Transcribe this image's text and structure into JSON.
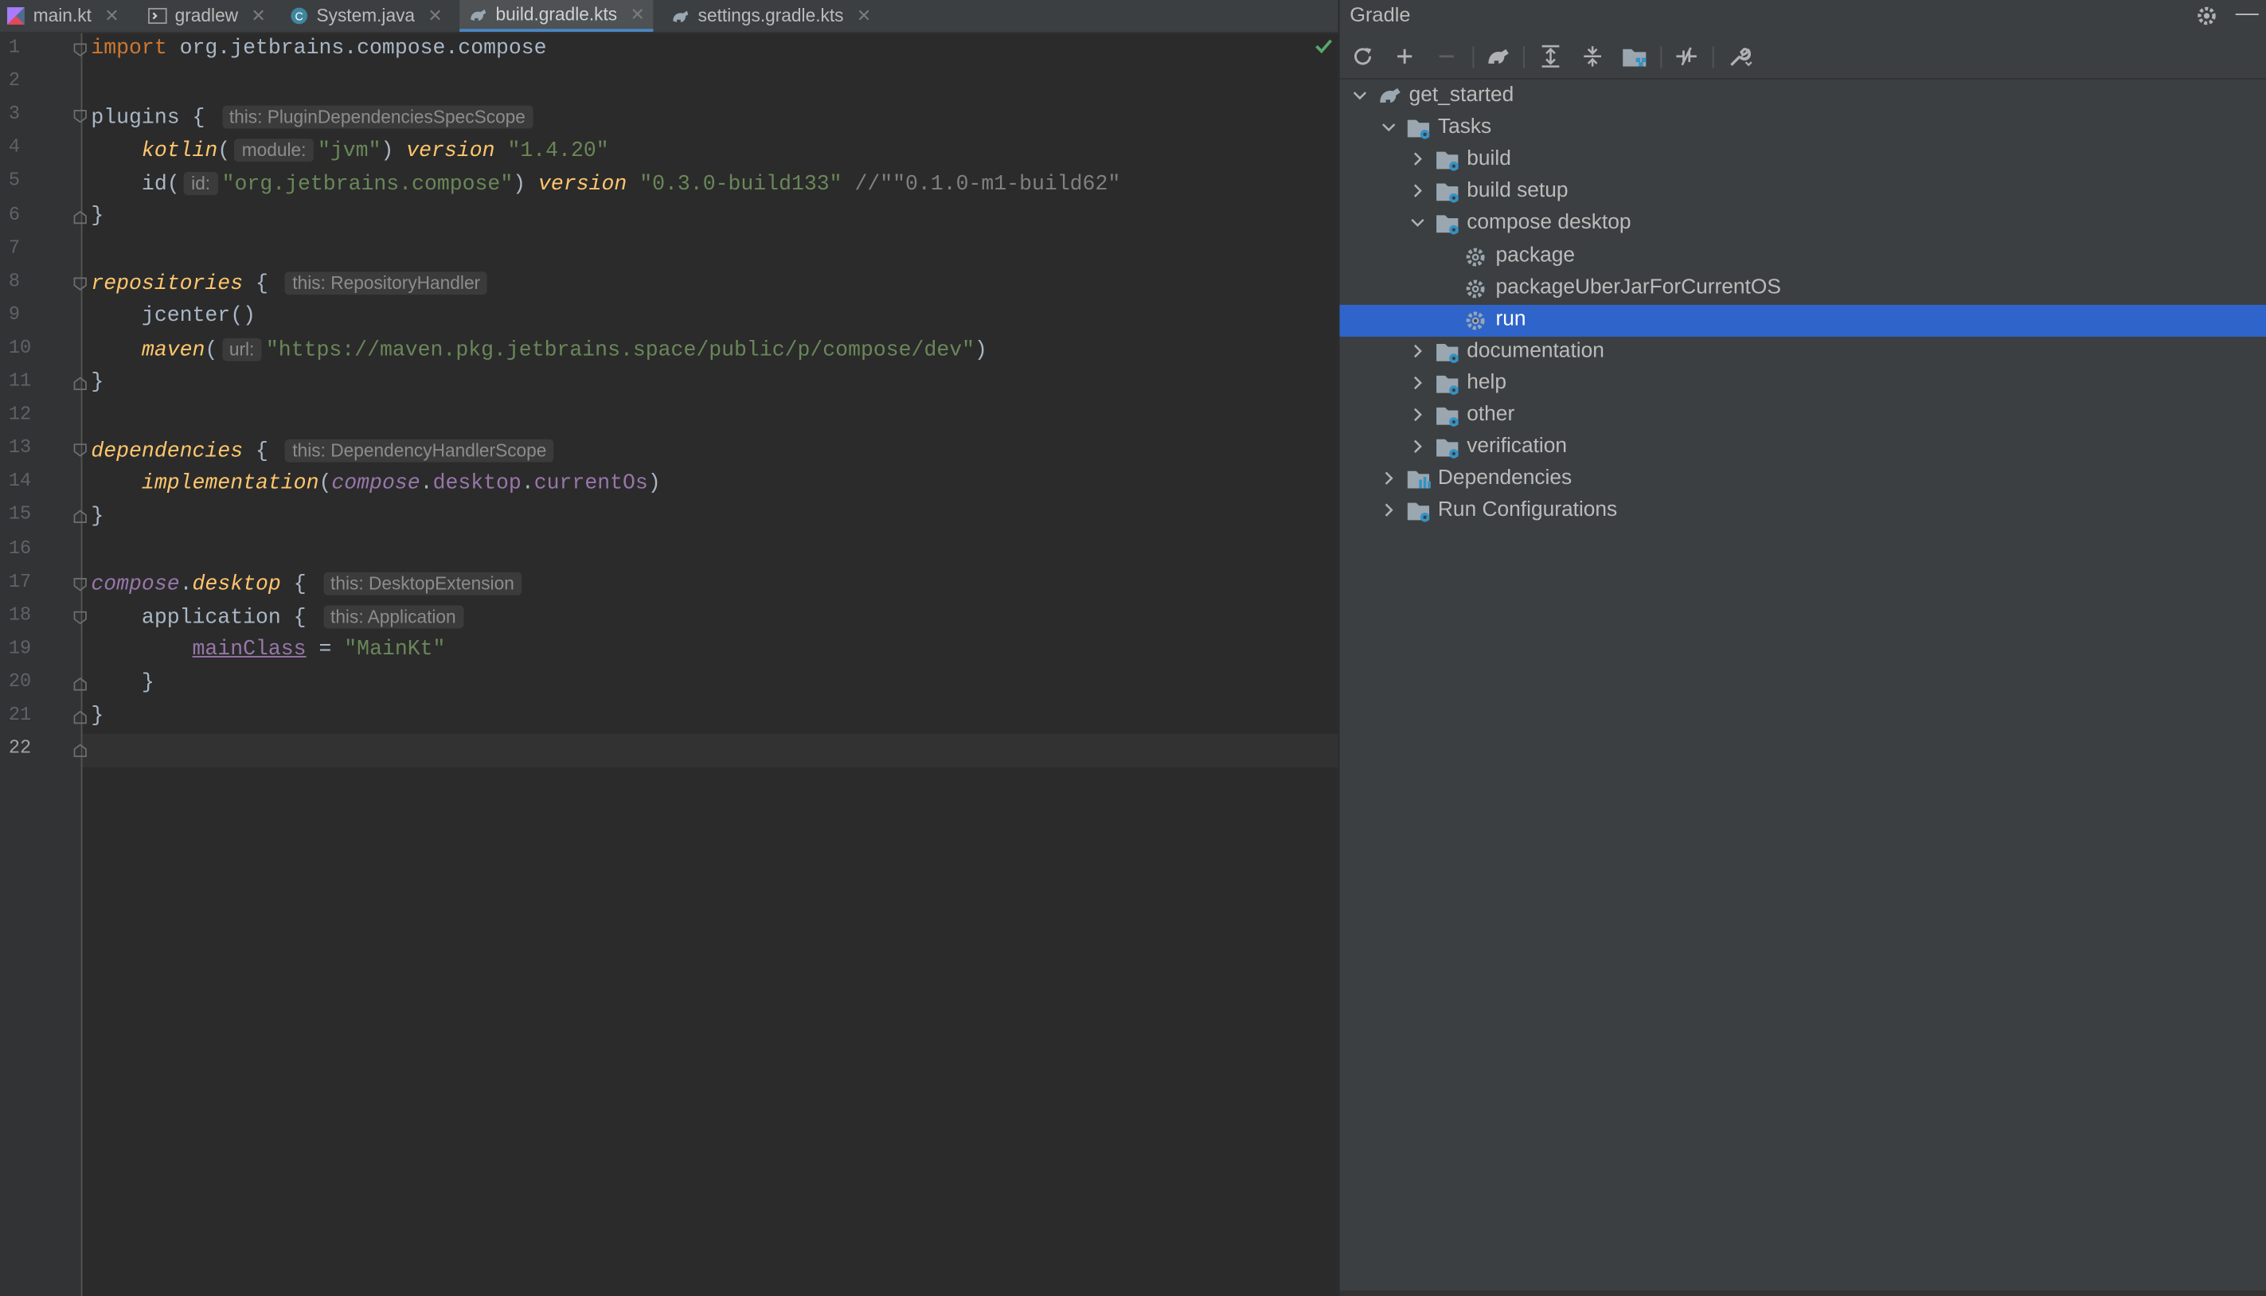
{
  "editor": {
    "tabs": [
      {
        "label": "main.kt",
        "icon": "kotlin-file-icon",
        "active": false
      },
      {
        "label": "gradlew",
        "icon": "terminal-file-icon",
        "active": false
      },
      {
        "label": "System.java",
        "icon": "java-class-icon",
        "active": false
      },
      {
        "label": "build.gradle.kts",
        "icon": "gradle-file-icon",
        "active": true
      },
      {
        "label": "settings.gradle.kts",
        "icon": "gradle-file-icon",
        "active": false
      }
    ],
    "line_numbers": [
      "1",
      "2",
      "3",
      "4",
      "5",
      "6",
      "7",
      "8",
      "9",
      "10",
      "11",
      "12",
      "13",
      "14",
      "15",
      "16",
      "17",
      "18",
      "19",
      "20",
      "21",
      "22"
    ],
    "current_line": "22",
    "code": {
      "l1": {
        "kw": "import",
        "rest": " org.jetbrains.compose.compose"
      },
      "l3": {
        "name": "plugins",
        "brace": " {",
        "hint": "this: PluginDependenciesSpecScope"
      },
      "l4": {
        "indent": "    ",
        "fn": "kotlin",
        "open": "(",
        "hint": "module:",
        "str": "\"jvm\"",
        "close": ") ",
        "fn2": "version",
        "sp": " ",
        "str2": "\"1.4.20\""
      },
      "l5": {
        "indent": "    ",
        "name": "id(",
        "hint": "id:",
        "str": "\"org.jetbrains.compose\"",
        "close": ") ",
        "fn2": "version",
        "sp": " ",
        "str2": "\"0.3.0-build133\"",
        "cm": " //\"\"0.1.0-m1-build62\""
      },
      "l6": {
        "text": "}"
      },
      "l8": {
        "fn": "repositories",
        "brace": " {",
        "hint": "this: RepositoryHandler"
      },
      "l9": {
        "text": "    jcenter()"
      },
      "l10": {
        "indent": "    ",
        "fn": "maven",
        "open": "(",
        "hint": "url:",
        "str": "\"https://maven.pkg.jetbrains.space/public/p/compose/dev\"",
        "close": ")"
      },
      "l11": {
        "text": "}"
      },
      "l13": {
        "fn": "dependencies",
        "brace": " {",
        "hint": "this: DependencyHandlerScope"
      },
      "l14": {
        "indent": "    ",
        "fn": "implementation",
        "open": "(",
        "p1": "compose",
        "dot1": ".",
        "p2": "desktop",
        "dot2": ".",
        "p3": "currentOs",
        "close": ")"
      },
      "l15": {
        "text": "}"
      },
      "l17": {
        "p1": "compose",
        "dot": ".",
        "fn": "desktop",
        "brace": " {",
        "hint": "this: DesktopExtension"
      },
      "l18": {
        "text": "    application {",
        "hint": "this: Application"
      },
      "l19": {
        "indent": "        ",
        "prop": "mainClass",
        "eq": " = ",
        "str": "\"MainKt\""
      },
      "l20": {
        "text": "    }"
      },
      "l21": {
        "text": "}"
      }
    }
  },
  "gradle": {
    "title": "Gradle",
    "toolbar": [
      "reload-icon",
      "plus-icon",
      "minus-icon",
      "elephant-icon",
      "expand-all-icon",
      "collapse-all-icon",
      "folder-dependencies-icon",
      "toggle-offline-icon",
      "wrench-icon"
    ],
    "tree": [
      {
        "label": "get_started",
        "level": 0,
        "expanded": true,
        "icon": "gradle-project-icon"
      },
      {
        "label": "Tasks",
        "level": 1,
        "expanded": true,
        "icon": "task-folder-icon"
      },
      {
        "label": "build",
        "level": 2,
        "expanded": false,
        "icon": "task-folder-icon"
      },
      {
        "label": "build setup",
        "level": 2,
        "expanded": false,
        "icon": "task-folder-icon"
      },
      {
        "label": "compose desktop",
        "level": 2,
        "expanded": true,
        "icon": "task-folder-icon"
      },
      {
        "label": "package",
        "level": 3,
        "icon": "gear-icon"
      },
      {
        "label": "packageUberJarForCurrentOS",
        "level": 3,
        "icon": "gear-icon"
      },
      {
        "label": "run",
        "level": 3,
        "icon": "gear-icon",
        "selected": true
      },
      {
        "label": "documentation",
        "level": 2,
        "expanded": false,
        "icon": "task-folder-icon"
      },
      {
        "label": "help",
        "level": 2,
        "expanded": false,
        "icon": "task-folder-icon"
      },
      {
        "label": "other",
        "level": 2,
        "expanded": false,
        "icon": "task-folder-icon"
      },
      {
        "label": "verification",
        "level": 2,
        "expanded": false,
        "icon": "task-folder-icon"
      },
      {
        "label": "Dependencies",
        "level": 1,
        "expanded": false,
        "icon": "dependencies-icon"
      },
      {
        "label": "Run Configurations",
        "level": 1,
        "expanded": false,
        "icon": "task-folder-icon"
      }
    ]
  },
  "colors": {
    "accent": "#2f65ca",
    "string": "#6a8759",
    "keyword": "#cc7832",
    "function": "#ffc66d",
    "property": "#9876aa"
  }
}
